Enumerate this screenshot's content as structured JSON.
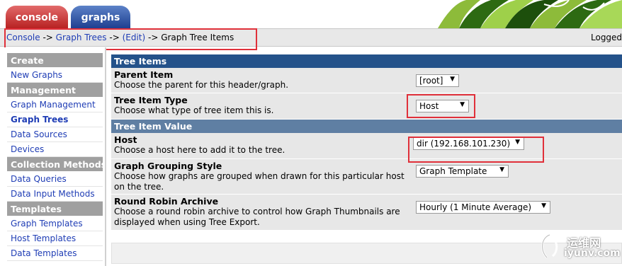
{
  "tabs": {
    "console": "console",
    "graphs": "graphs"
  },
  "breadcrumb": {
    "console": "Console",
    "sep1": " -> ",
    "graph_trees": "Graph Trees",
    "sep2": " -> ",
    "edit": "(Edit)",
    "sep3": " -> ",
    "current": "Graph Tree Items"
  },
  "logged_text": "Logged",
  "sidebar": {
    "create_header": "Create",
    "new_graphs": "New Graphs",
    "management_header": "Management",
    "graph_management": "Graph Management",
    "graph_trees": "Graph Trees",
    "data_sources": "Data Sources",
    "devices": "Devices",
    "collection_header": "Collection Methods",
    "data_queries": "Data Queries",
    "data_input_methods": "Data Input Methods",
    "templates_header": "Templates",
    "graph_templates": "Graph Templates",
    "host_templates": "Host Templates",
    "data_templates": "Data Templates"
  },
  "form": {
    "tree_items_header": "Tree Items",
    "parent_item": {
      "title": "Parent Item",
      "desc": "Choose the parent for this header/graph.",
      "value": "[root]"
    },
    "tree_item_type": {
      "title": "Tree Item Type",
      "desc": "Choose what type of tree item this is.",
      "value": "Host"
    },
    "tree_item_value_header": "Tree Item Value",
    "host": {
      "title": "Host",
      "desc": "Choose a host here to add it to the tree.",
      "value": "dir (192.168.101.230)"
    },
    "grouping": {
      "title": "Graph Grouping Style",
      "desc": "Choose how graphs are grouped when drawn for this particular host on the tree.",
      "value": "Graph Template"
    },
    "rra": {
      "title": "Round Robin Archive",
      "desc": "Choose a round robin archive to control how Graph Thumbnails are displayed when using Tree Export.",
      "value": "Hourly (1 Minute Average)"
    }
  },
  "watermark": {
    "line1": "运维网",
    "line2": "iyunv.com"
  },
  "colors": {
    "section_header": "#24528a",
    "highlight_box": "#e0303a",
    "link": "#1f3db5"
  }
}
